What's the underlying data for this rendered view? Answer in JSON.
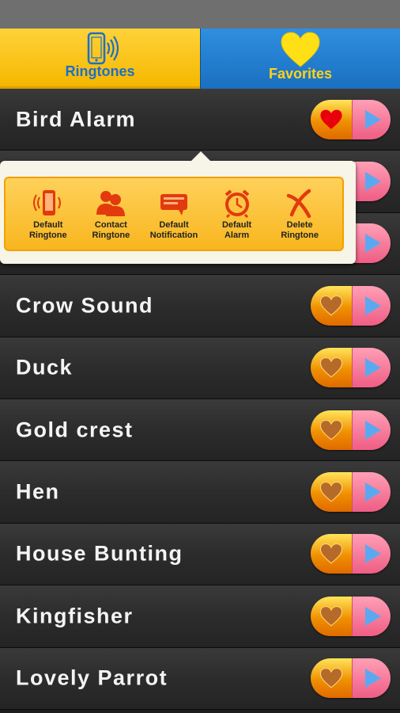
{
  "tabs": [
    {
      "label": "Ringtones",
      "icon": "phone-vibrate-icon",
      "active": true
    },
    {
      "label": "Favorites",
      "icon": "heart-icon",
      "active": false
    }
  ],
  "ringtones": [
    {
      "title": "Bird Alarm",
      "favorited": true
    },
    {
      "title": "",
      "favorited": false
    },
    {
      "title": "",
      "favorited": false
    },
    {
      "title": "Crow Sound",
      "favorited": false
    },
    {
      "title": "Duck",
      "favorited": false
    },
    {
      "title": "Gold crest",
      "favorited": false
    },
    {
      "title": "Hen",
      "favorited": false
    },
    {
      "title": "House Bunting",
      "favorited": false
    },
    {
      "title": "Kingfisher",
      "favorited": false
    },
    {
      "title": "Lovely Parrot",
      "favorited": false
    }
  ],
  "popup": {
    "actions": [
      {
        "label_line1": "Default",
        "label_line2": "Ringtone",
        "icon": "phone-ring-icon"
      },
      {
        "label_line1": "Contact",
        "label_line2": "Ringtone",
        "icon": "contacts-icon"
      },
      {
        "label_line1": "Default",
        "label_line2": "Notification",
        "icon": "notification-icon"
      },
      {
        "label_line1": "Default",
        "label_line2": "Alarm",
        "icon": "alarm-clock-icon"
      },
      {
        "label_line1": "Delete",
        "label_line2": "Ringtone",
        "icon": "delete-icon"
      }
    ]
  },
  "colors": {
    "active_tab": "#ffd23a",
    "inactive_tab": "#1a6fc0",
    "fav_heart_active": "#e8000a",
    "fav_heart_inactive": "#b56a2a",
    "play_button": "#ef5d85",
    "play_triangle": "#5aa9f0"
  }
}
